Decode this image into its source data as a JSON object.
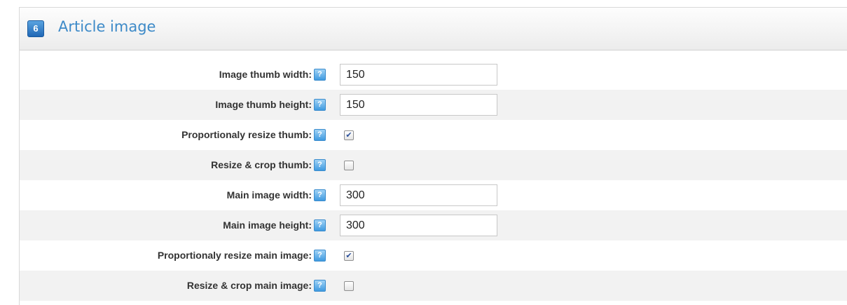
{
  "section": {
    "step_number": "6",
    "title": "Article image"
  },
  "icons": {
    "help": "info-icon",
    "help_glyph": "?"
  },
  "fields": [
    {
      "label": "Image thumb width:",
      "type": "text",
      "value": "150"
    },
    {
      "label": "Image thumb height:",
      "type": "text",
      "value": "150"
    },
    {
      "label": "Proportionaly resize thumb:",
      "type": "checkbox",
      "checked": true,
      "mark": "✔"
    },
    {
      "label": "Resize & crop thumb:",
      "type": "checkbox",
      "checked": false,
      "mark": ""
    },
    {
      "label": "Main image width:",
      "type": "text",
      "value": "300"
    },
    {
      "label": "Main image height:",
      "type": "text",
      "value": "300"
    },
    {
      "label": "Proportionaly resize main image:",
      "type": "checkbox",
      "checked": true,
      "mark": "✔"
    },
    {
      "label": "Resize & crop main image:",
      "type": "checkbox",
      "checked": false,
      "mark": ""
    }
  ],
  "colors": {
    "accent": "#3d8ac8",
    "badge": "#1f67b5",
    "alt_row": "#f2f2f2"
  }
}
